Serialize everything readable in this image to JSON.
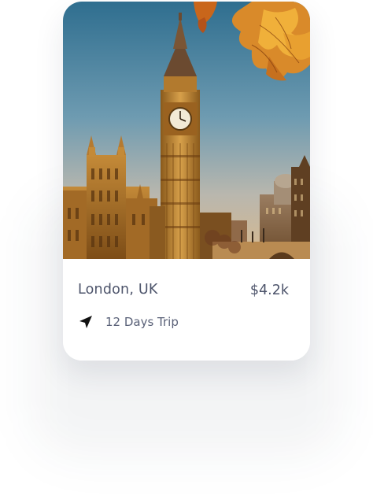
{
  "destination_card": {
    "image_alt": "Big Ben, Palace of Westminster, autumn leaves",
    "location": "London, UK",
    "price": "$4.2k",
    "trip_duration": "12 Days Trip",
    "icons": {
      "trip": "navigation-arrow-icon"
    }
  },
  "colors": {
    "text_primary": "#4d546b",
    "text_secondary": "#5a6178",
    "card_bg": "#ffffff"
  }
}
